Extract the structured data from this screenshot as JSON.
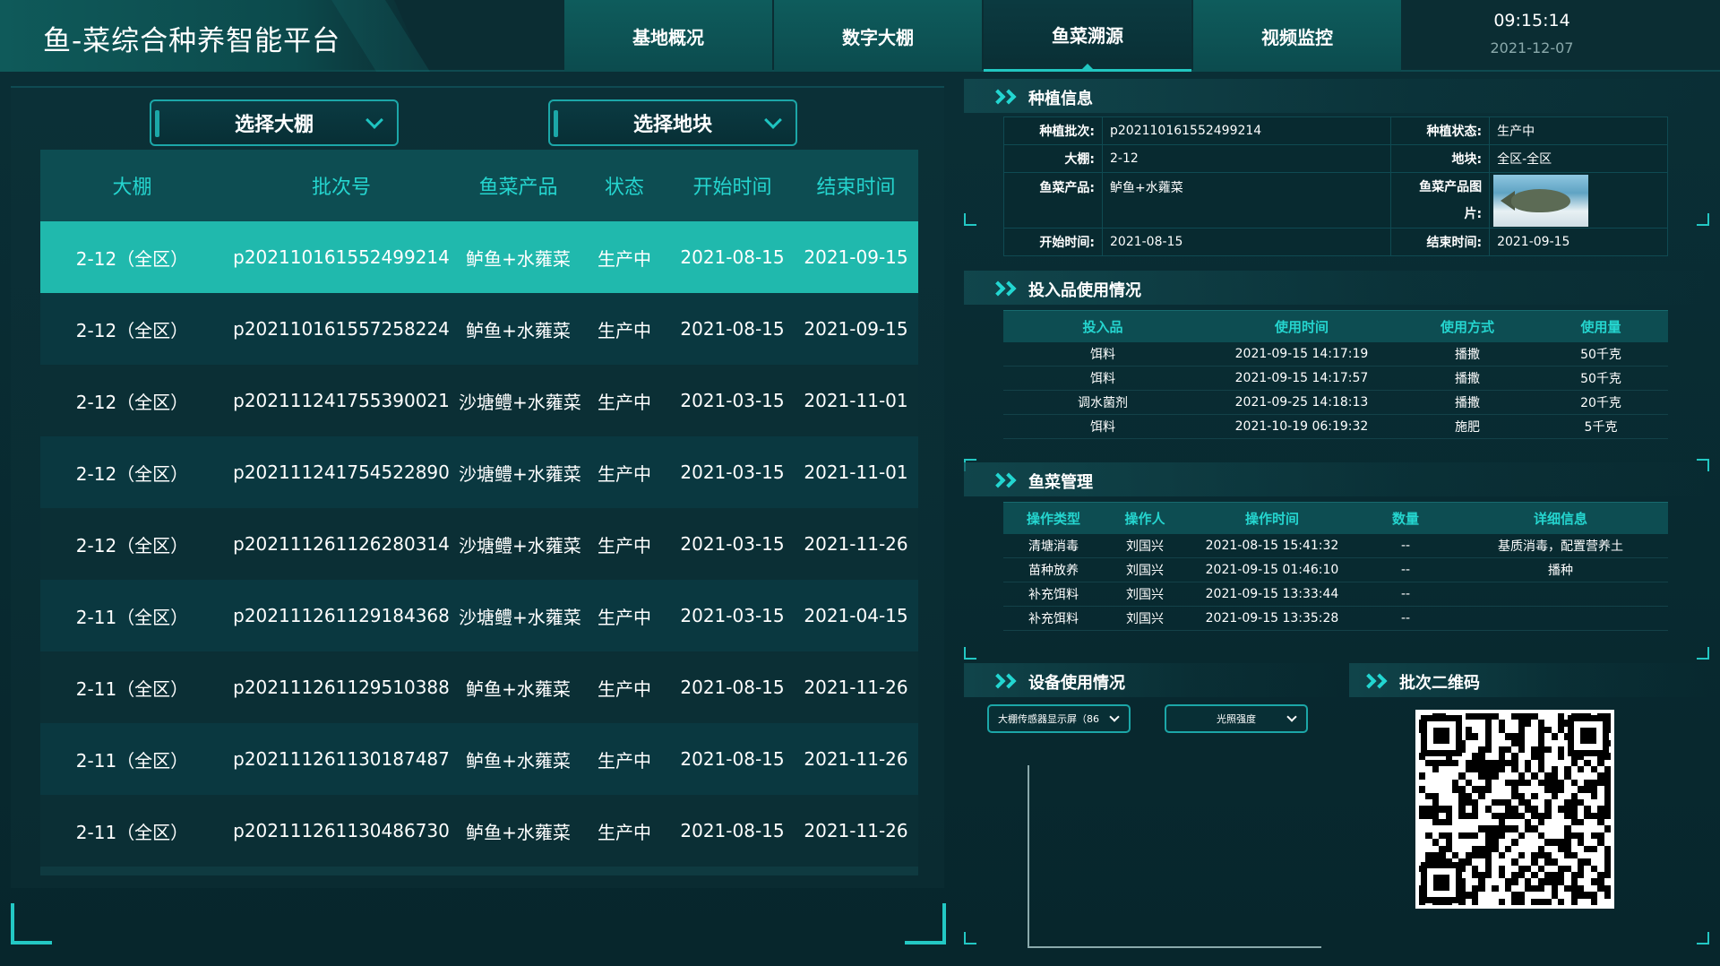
{
  "header": {
    "title": "鱼-菜综合种养智能平台",
    "tabs": [
      "基地概况",
      "数字大棚",
      "鱼菜溯源",
      "视频监控"
    ],
    "active_tab_index": 2,
    "time": "09:15:14",
    "date": "2021-12-07"
  },
  "filters": {
    "greenhouse": "选择大棚",
    "plot": "选择地块"
  },
  "batch_table": {
    "columns": [
      "大棚",
      "批次号",
      "鱼菜产品",
      "状态",
      "开始时间",
      "结束时间"
    ],
    "rows": [
      [
        "2-12（全区）",
        "p202110161552499214",
        "鲈鱼+水蕹菜",
        "生产中",
        "2021-08-15",
        "2021-09-15"
      ],
      [
        "2-12（全区）",
        "p202110161557258224",
        "鲈鱼+水蕹菜",
        "生产中",
        "2021-08-15",
        "2021-09-15"
      ],
      [
        "2-12（全区）",
        "p202111241755390021",
        "沙塘鳢+水蕹菜",
        "生产中",
        "2021-03-15",
        "2021-11-01"
      ],
      [
        "2-12（全区）",
        "p202111241754522890",
        "沙塘鳢+水蕹菜",
        "生产中",
        "2021-03-15",
        "2021-11-01"
      ],
      [
        "2-12（全区）",
        "p202111261126280314",
        "沙塘鳢+水蕹菜",
        "生产中",
        "2021-03-15",
        "2021-11-26"
      ],
      [
        "2-11（全区）",
        "p202111261129184368",
        "沙塘鳢+水蕹菜",
        "生产中",
        "2021-03-15",
        "2021-04-15"
      ],
      [
        "2-11（全区）",
        "p202111261129510388",
        "鲈鱼+水蕹菜",
        "生产中",
        "2021-08-15",
        "2021-11-26"
      ],
      [
        "2-11（全区）",
        "p202111261130187487",
        "鲈鱼+水蕹菜",
        "生产中",
        "2021-08-15",
        "2021-11-26"
      ],
      [
        "2-11（全区）",
        "p202111261130486730",
        "鲈鱼+水蕹菜",
        "生产中",
        "2021-08-15",
        "2021-11-26"
      ]
    ],
    "selected_row_index": 0
  },
  "planting_info": {
    "title": "种植信息",
    "batch_label": "种植批次:",
    "batch_value": "p202110161552499214",
    "status_label": "种植状态:",
    "status_value": "生产中",
    "greenhouse_label": "大棚:",
    "greenhouse_value": "2-12",
    "plot_label": "地块:",
    "plot_value": "全区-全区",
    "product_label": "鱼菜产品:",
    "product_value": "鲈鱼+水蕹菜",
    "image_label_line1": "鱼菜产品图",
    "image_label_line2": "片:",
    "start_label": "开始时间:",
    "start_value": "2021-08-15",
    "end_label": "结束时间:",
    "end_value": "2021-09-15"
  },
  "inputs_usage": {
    "title": "投入品使用情况",
    "columns": [
      "投入品",
      "使用时间",
      "使用方式",
      "使用量"
    ],
    "rows": [
      [
        "饵料",
        "2021-09-15 14:17:19",
        "播撒",
        "50千克"
      ],
      [
        "饵料",
        "2021-09-15 14:17:57",
        "播撒",
        "50千克"
      ],
      [
        "调水菌剂",
        "2021-09-25 14:18:13",
        "播撒",
        "20千克"
      ],
      [
        "饵料",
        "2021-10-19 06:19:32",
        "施肥",
        "5千克"
      ]
    ]
  },
  "management": {
    "title": "鱼菜管理",
    "columns": [
      "操作类型",
      "操作人",
      "操作时间",
      "数量",
      "详细信息"
    ],
    "rows": [
      [
        "清塘消毒",
        "刘国兴",
        "2021-08-15 15:41:32",
        "--",
        "基质消毒，配置营养土"
      ],
      [
        "苗种放养",
        "刘国兴",
        "2021-09-15 01:46:10",
        "--",
        "播种"
      ],
      [
        "补充饵料",
        "刘国兴",
        "2021-09-15 13:33:44",
        "--",
        ""
      ],
      [
        "补充饵料",
        "刘国兴",
        "2021-09-15 13:35:28",
        "--",
        ""
      ]
    ]
  },
  "device_usage": {
    "title": "设备使用情况",
    "device_select": "大棚传感器显示屏（86",
    "metric_select": "光照强度"
  },
  "qr_section": {
    "title": "批次二维码"
  },
  "colors": {
    "accent": "#21c7c1",
    "selected_row": "#20b9ad",
    "header_cell": "#0d4d52"
  }
}
